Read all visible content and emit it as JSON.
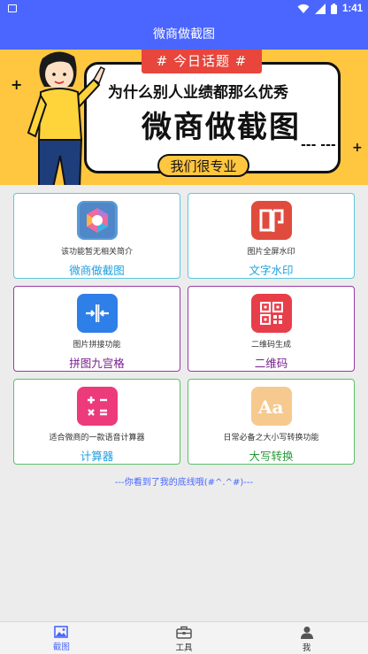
{
  "status_bar": {
    "time": "1:41",
    "icons": [
      "screenshot-icon",
      "wifi-icon",
      "signal-icon",
      "battery-icon"
    ]
  },
  "app_bar": {
    "title": "微商做截图"
  },
  "banner": {
    "ribbon": "# 今日话题 #",
    "line1": "为什么别人业绩都那么优秀",
    "line2": "微商做截图",
    "pill": "我们很专业",
    "dots": "--- ---"
  },
  "tools": [
    {
      "desc": "该功能暂无相关简介",
      "name": "微商做截图",
      "icon": "app-logo-icon",
      "border": "#5cc6dc",
      "name_color": "#1e9fe0"
    },
    {
      "desc": "图片全屏水印",
      "name": "文字水印",
      "icon": "watermark-icon",
      "border": "#5cc6dc",
      "name_color": "#1e9fe0"
    },
    {
      "desc": "图片拼接功能",
      "name": "拼图九宫格",
      "icon": "puzzle-icon",
      "border": "#9a3aa8",
      "name_color": "#7a1f8f"
    },
    {
      "desc": "二维码生成",
      "name": "二维码",
      "icon": "qrcode-icon",
      "border": "#9a3aa8",
      "name_color": "#7a1f8f"
    },
    {
      "desc": "适合微商的一款语音计算器",
      "name": "计算器",
      "icon": "calculator-icon",
      "border": "#5cc06a",
      "name_color": "#1e9fe0"
    },
    {
      "desc": "日常必备之大小写转换功能",
      "name": "大写转换",
      "icon": "font-case-icon",
      "border": "#5cc06a",
      "name_color": "#2a9a3a"
    }
  ],
  "footer_note": "---你看到了我的底线哦(#^.^#)---",
  "tab_bar": {
    "items": [
      {
        "label": "截图",
        "icon": "image-icon",
        "active": true
      },
      {
        "label": "工具",
        "icon": "toolbox-icon",
        "active": false
      },
      {
        "label": "我",
        "icon": "person-icon",
        "active": false
      }
    ]
  },
  "colors": {
    "brand": "#4a66ff",
    "banner_yellow": "#ffc63f",
    "ribbon_red": "#e8453c"
  }
}
